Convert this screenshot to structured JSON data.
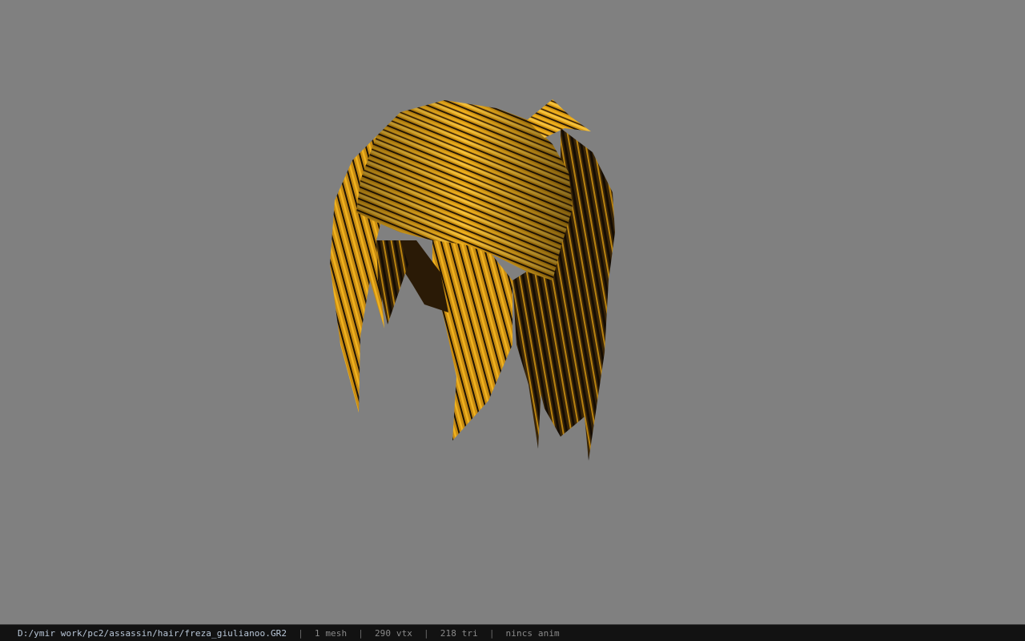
{
  "viewer": {
    "background_color": "#808080",
    "model": {
      "icon": "hair-mesh-icon",
      "colors": {
        "light": "#f0b21f",
        "mid": "#c98c10",
        "dark": "#1a1006"
      }
    }
  },
  "status": {
    "file_path": "D:/ymir work/pc2/assassin/hair/freza_giulianoo.GR2",
    "separator": "|",
    "mesh_count": "1 mesh",
    "vertex_count": "290 vtx",
    "triangle_count": "218 tri",
    "anim_info": "nincs anim"
  }
}
